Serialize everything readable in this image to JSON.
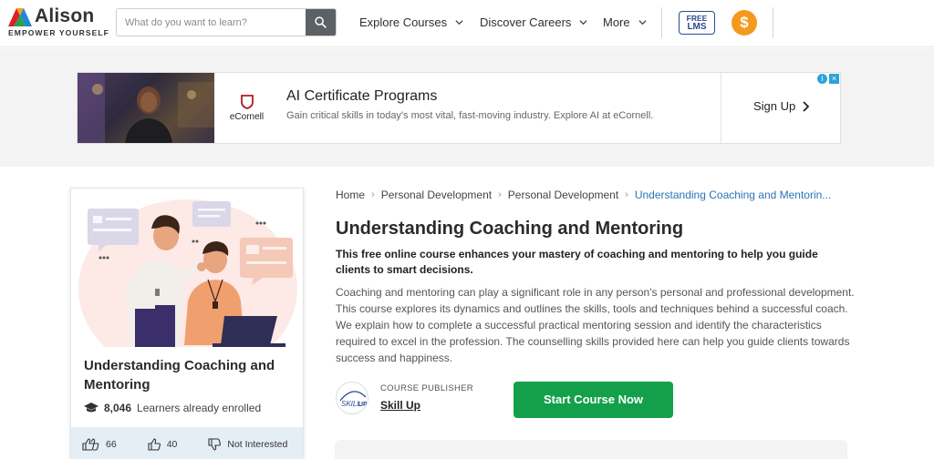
{
  "header": {
    "logo_text": "Alison",
    "logo_tagline": "EMPOWER YOURSELF",
    "search_placeholder": "What do you want to learn?",
    "nav": [
      {
        "label": "Explore Courses"
      },
      {
        "label": "Discover Careers"
      },
      {
        "label": "More"
      }
    ],
    "free_lms_line1": "FREE",
    "free_lms_line2": "LMS",
    "coin_symbol": "$"
  },
  "ad": {
    "brand_name": "eCornell",
    "title": "AI Certificate Programs",
    "subtitle": "Gain critical skills in today's most vital, fast-moving industry. Explore AI at eCornell.",
    "cta_label": "Sign Up"
  },
  "course_card": {
    "title": "Understanding Coaching and Mentoring",
    "enrolled_count": "8,046",
    "enrolled_label": "Learners already enrolled",
    "likes": "66",
    "thumbs_up": "40",
    "not_interested_label": "Not Interested"
  },
  "breadcrumb": {
    "items": [
      "Home",
      "Personal Development",
      "Personal Development"
    ],
    "current": "Understanding Coaching and Mentorin..."
  },
  "course": {
    "title": "Understanding Coaching and Mentoring",
    "tagline": "This free online course enhances your mastery of coaching and mentoring to help you guide clients to smart decisions.",
    "description": "Coaching and mentoring can play a significant role in any person's personal and professional development. This course explores its dynamics and outlines the skills, tools and techniques behind a successful coach. We explain how to complete a successful practical mentoring session and identify the characteristics required to excel in the profession. The counselling skills provided here can help you guide clients towards success and happiness.",
    "publisher_label": "COURSE PUBLISHER",
    "publisher_name": "Skill Up",
    "start_button": "Start Course Now"
  },
  "colors": {
    "accent_green": "#14a04b",
    "link_blue": "#2a73b8",
    "coin_orange": "#f39a1e",
    "lms_blue": "#2a4b8d"
  }
}
